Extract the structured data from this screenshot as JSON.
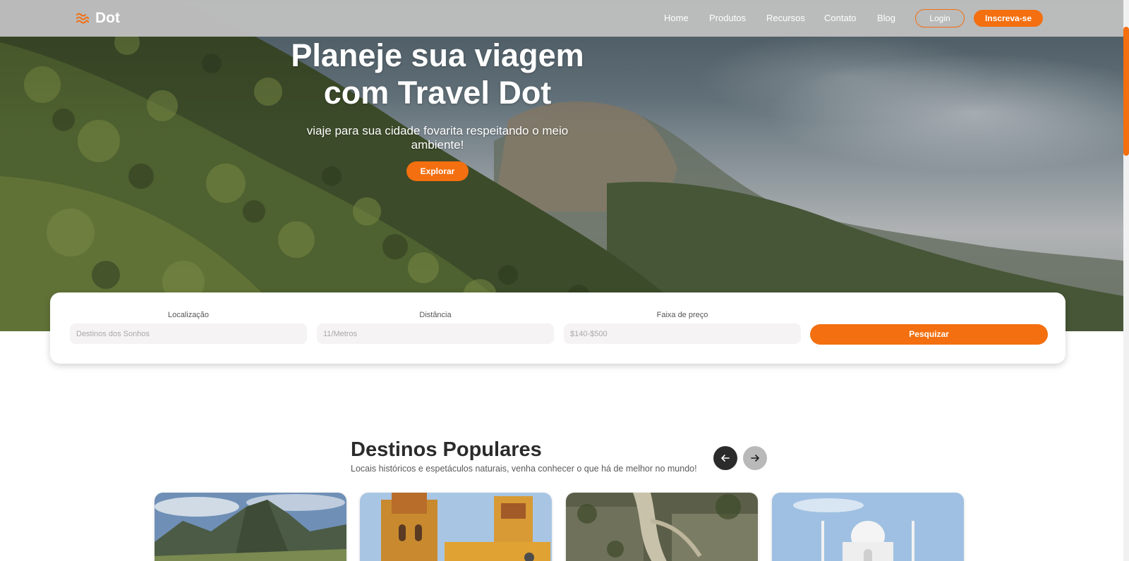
{
  "brand": {
    "name": "Dot",
    "icon": "waves-icon",
    "accent": "#f36f0f"
  },
  "nav": {
    "links": [
      "Home",
      "Produtos",
      "Recursos",
      "Contato",
      "Blog"
    ],
    "login_label": "Login",
    "signup_label": "Inscreva-se"
  },
  "hero": {
    "title_line1": "Planeje sua viagem",
    "title_line2": "com Travel Dot",
    "subtitle": "viaje para sua cidade fovarita respeitando o meio ambiente!",
    "cta_label": "Explorar"
  },
  "search": {
    "location_label": "Localização",
    "location_placeholder": "Destinos dos Sonhos",
    "distance_label": "Distância",
    "distance_placeholder": "11/Metros",
    "price_label": "Faixa de preço",
    "price_placeholder": "$140-$500",
    "submit_label": "Pesquizar"
  },
  "popular": {
    "title": "Destinos Populares",
    "subtitle": "Locais históricos e espetáculos naturais, venha conhecer o que há de melhor no mundo!",
    "prev_icon": "arrow-left-icon",
    "next_icon": "arrow-right-icon"
  }
}
